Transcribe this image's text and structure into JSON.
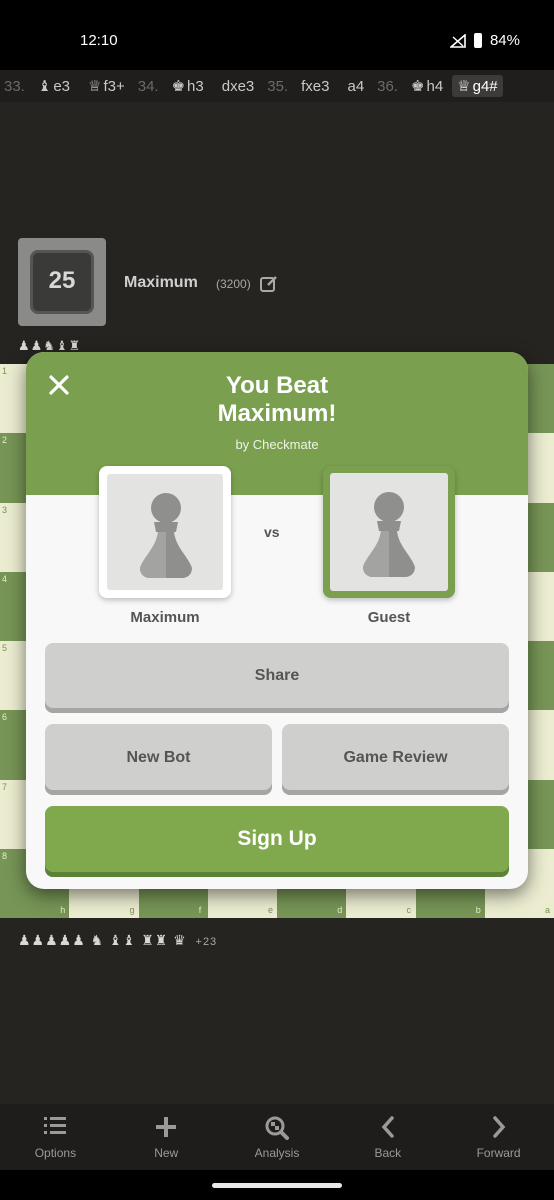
{
  "status_bar": {
    "time": "12:10",
    "battery": "84%"
  },
  "move_list": [
    {
      "kind": "num",
      "text": "33."
    },
    {
      "kind": "mv",
      "piece": "♝",
      "text": "e3"
    },
    {
      "kind": "mv",
      "piece": "♕",
      "text": "f3+"
    },
    {
      "kind": "num",
      "text": "34."
    },
    {
      "kind": "mv",
      "piece": "♚",
      "text": "h3"
    },
    {
      "kind": "mv",
      "piece": "",
      "text": "dxe3"
    },
    {
      "kind": "num",
      "text": "35."
    },
    {
      "kind": "mv",
      "piece": "",
      "text": "fxe3"
    },
    {
      "kind": "mv",
      "piece": "",
      "text": "a4"
    },
    {
      "kind": "num",
      "text": "36."
    },
    {
      "kind": "mv",
      "piece": "♚",
      "text": "h4"
    },
    {
      "kind": "current",
      "piece": "♕",
      "text": "g4#"
    }
  ],
  "opponent": {
    "avatar_number": "25",
    "name": "Maximum",
    "rating": "(3200)",
    "captured": "♟♟♞♝♜"
  },
  "board": {
    "ranks": [
      "1",
      "2",
      "3",
      "4",
      "5",
      "6",
      "7",
      "8"
    ],
    "files": [
      "h",
      "g",
      "f",
      "e",
      "d",
      "c",
      "b",
      "a"
    ],
    "light": "#ebecd0",
    "dark": "#779556"
  },
  "my_captured": {
    "pieces": "♟♟♟♟♟ ♞ ♝♝ ♜♜ ♛",
    "advantage": "+23"
  },
  "modal": {
    "title_line1": "You Beat",
    "title_line2": "Maximum!",
    "subtitle": "by Checkmate",
    "vs": "vs",
    "player_left": "Maximum",
    "player_right": "Guest",
    "share_label": "Share",
    "new_bot_label": "New Bot",
    "game_review_label": "Game Review",
    "sign_up_label": "Sign Up",
    "accent": "#7aa04f"
  },
  "bottom_nav": [
    {
      "label": "Options",
      "icon": "list-icon"
    },
    {
      "label": "New",
      "icon": "plus-icon"
    },
    {
      "label": "Analysis",
      "icon": "analysis-icon"
    },
    {
      "label": "Back",
      "icon": "chevron-left-icon"
    },
    {
      "label": "Forward",
      "icon": "chevron-right-icon"
    }
  ]
}
